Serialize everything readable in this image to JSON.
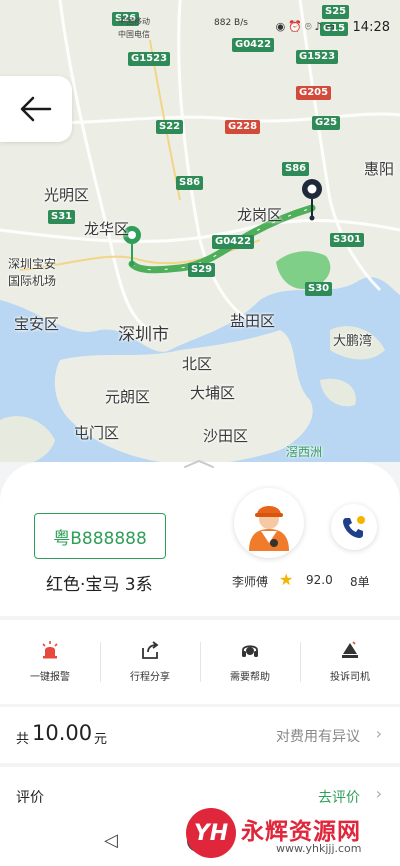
{
  "status_bar": {
    "carrier1": "中国移动",
    "carrier2": "中国电信",
    "speed": "882 B/s",
    "time": "14:28"
  },
  "map": {
    "places": {
      "guangming": "光明区",
      "longhua": "龙华区",
      "longgang": "龙岗区",
      "huizhou": "惠阳",
      "airport1": "深圳宝安",
      "airport2": "国际机场",
      "baoan": "宝安区",
      "shenzhen": "深圳市",
      "yantian": "盐田区",
      "dapeng": "大鹏湾",
      "beiqu": "北区",
      "yuanlang": "元朗区",
      "dabu": "大埔区",
      "tunmen": "屯门区",
      "shatian": "沙田区",
      "xizhou": "滘西洲"
    },
    "highways": [
      "S26",
      "G15",
      "G1523",
      "G0422",
      "S25",
      "G1523",
      "G205",
      "S22",
      "G228",
      "G25",
      "S86",
      "S86",
      "S31",
      "G0422",
      "S29",
      "S301",
      "S30"
    ]
  },
  "trip": {
    "plate": "粤B888888",
    "car": "红色·宝马 3系",
    "driver_name": "李师傅",
    "rating": "92.0",
    "orders": "8单"
  },
  "actions": [
    {
      "label": "一键报警",
      "icon": "alarm-icon"
    },
    {
      "label": "行程分享",
      "icon": "share-icon"
    },
    {
      "label": "需要帮助",
      "icon": "headset-icon"
    },
    {
      "label": "投诉司机",
      "icon": "complaint-icon"
    }
  ],
  "fee": {
    "prefix": "共",
    "amount": "10.00",
    "unit": "元",
    "dispute": "对费用有异议"
  },
  "rating_row": {
    "label": "评价",
    "link": "去评价"
  },
  "watermark": {
    "logo": "YH",
    "title": "永辉资源网",
    "url": "www.yhkjjj.com"
  },
  "colors": {
    "accent": "#2f9e58",
    "route": "#4fae5a",
    "water": "#b9d6f2",
    "watermark": "#e0263a"
  }
}
